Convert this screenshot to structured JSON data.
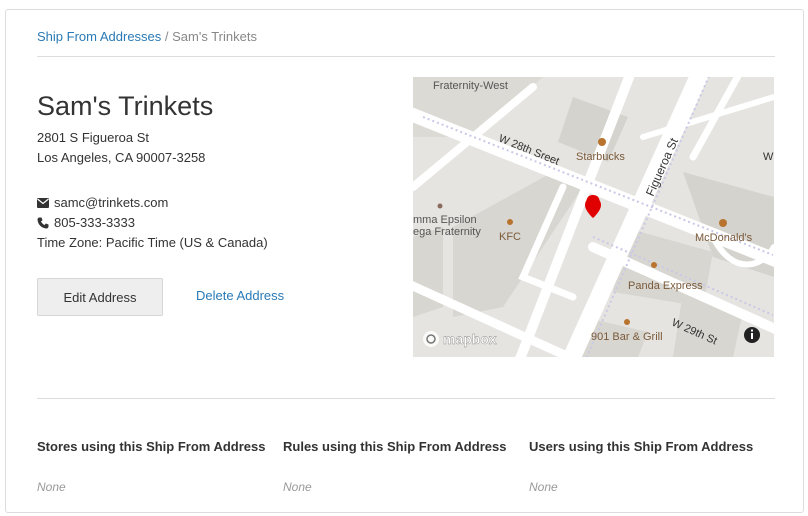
{
  "breadcrumb": {
    "parent": "Ship From Addresses",
    "separator": " / ",
    "current": "Sam's Trinkets"
  },
  "address": {
    "name": "Sam's Trinkets",
    "street": "2801 S Figueroa St",
    "city_line": "Los Angeles, CA 90007-3258"
  },
  "contact": {
    "email": "samc@trinkets.com",
    "phone": "805-333-3333",
    "timezone": "Time Zone: Pacific Time (US & Canada)"
  },
  "actions": {
    "edit_label": "Edit Address",
    "delete_label": "Delete Address"
  },
  "map": {
    "labels": {
      "fraternity_west": "Fraternity-West",
      "w28": "W 28th Sreet",
      "figueroa": "Figueroa St",
      "starbucks": "Starbucks",
      "mcdonalds": "McDonald's",
      "kfc": "KFC",
      "panda": "Panda Express",
      "bar": "901 Bar & Grill",
      "w29": "W 29th St",
      "emma_epsilon": "mma Epsilon",
      "ega_fraternity": "ega Fraternity",
      "w_edge": "W",
      "mapbox": "mapbox"
    },
    "marker_color": "#e00000"
  },
  "usage": {
    "stores_heading": "Stores using this Ship From Address",
    "stores_value": "None",
    "rules_heading": "Rules using this Ship From Address",
    "rules_value": "None",
    "users_heading": "Users using this Ship From Address",
    "users_value": "None"
  },
  "colors": {
    "link": "#2a7ab5",
    "muted": "#999999",
    "border": "#dddddd"
  }
}
